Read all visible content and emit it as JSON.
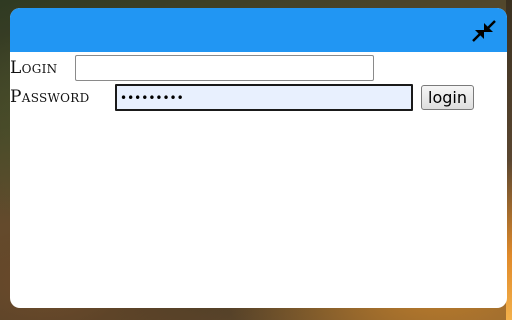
{
  "dialog": {
    "collapse_icon": "collapse-arrows-icon",
    "titlebar_color": "#2196f3"
  },
  "form": {
    "login_label": "Login",
    "login_value": "",
    "password_label": "Password",
    "password_value": "•••••••••",
    "submit_label": "login"
  }
}
